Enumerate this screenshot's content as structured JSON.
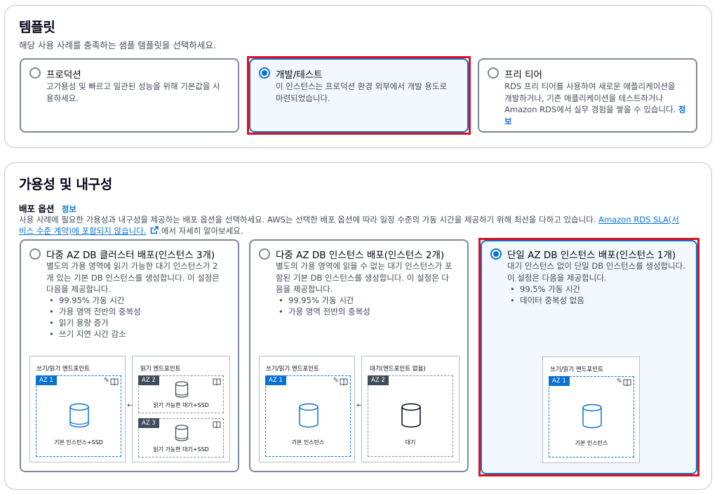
{
  "templates": {
    "title": "템플릿",
    "description": "해당 사용 사례를 충족하는 샘플 템플릿을 선택하세요.",
    "options": [
      {
        "label": "프로덕션",
        "desc_lines": [
          "고가용성 및 빠르고 일관된 성능을 위해 기본값을 사",
          "용하세요."
        ]
      },
      {
        "label": "개발/테스트",
        "desc_lines": [
          "이 인스턴스는 프로덕션 환경 외부에서 개발 용도로",
          "마련되었습니다."
        ]
      },
      {
        "label": "프리 티어",
        "desc_lines": [
          "RDS 프리 티어를 사용하여 새로운 애플리케이션을",
          "개발하거나, 기존 애플리케이션을 테스트하거나",
          "Amazon RDS에서 실무 경험을 쌓을 수 있습니다."
        ],
        "info_link_1": "정",
        "info_link_2": "보"
      }
    ],
    "selected": "개발/테스트"
  },
  "availability": {
    "title": "가용성 및 내구성",
    "deploy_label": "배포 옵션",
    "info_link": "정보",
    "desc_line1": "사용 사례에 필요한 가용성과 내구성을 제공하는 배포 옵션을 선택하세요. AWS는 선택한 배포 옵션에 따라 일정 수준의 가동 시간을 제공하기 위해 최선을 다하고 있습니다.",
    "sla_link_1": "Amazon RDS SLA(서",
    "sla_link_2": "비스 수준 계약)에 포함되지 않습니다.",
    "desc_tail": ".에서 자세히 알아보세요.",
    "options": [
      {
        "label": "다중 AZ DB 클러스터 배포(인스턴스 3개)",
        "desc_lines": [
          "별도의 가용 영역에 읽기 가능한 대기 인스턴스가 2",
          "개 있는 기본 DB 인스턴스를 생성합니다. 이 설정은",
          "다음을 제공합니다."
        ],
        "bullets": [
          "99.95% 가동 시간",
          "가용 영역 전반의 중복성",
          "읽기 용량 증가",
          "쓰기 지연 시간 감소"
        ],
        "diagram": {
          "write_ep": "쓰기/읽기 엔드포인트",
          "read_ep": "읽기 엔드포인트",
          "az1": "AZ 1",
          "az2": "AZ 2",
          "az3": "AZ 3",
          "primary": "기본 인스턴스+SSD",
          "readable1": "읽기 가능한 대기+SSD",
          "readable2": "읽기 가능한 대기+SSD"
        }
      },
      {
        "label": "다중 AZ DB 인스턴스 배포(인스턴스 2개)",
        "desc_lines": [
          "별도의 가용 영역에 읽을 수 없는 대기 인스턴스가 포",
          "함된 기본 DB 인스턴스를 생성합니다. 이 설정은 다",
          "음을 제공합니다."
        ],
        "bullets": [
          "99.95% 가동 시간",
          "가용 영역 전반의 중복성"
        ],
        "diagram": {
          "write_ep": "쓰기/읽기 엔드포인트",
          "standby_ep": "대기(엔드포인트 없음)",
          "az1": "AZ 1",
          "az2": "AZ 2",
          "primary": "기본 인스턴스",
          "standby": "대기"
        }
      },
      {
        "label": "단일 AZ DB 인스턴스 배포(인스턴스 1개)",
        "desc_lines": [
          "대기 인스턴스 없이 단일 DB 인스턴스를 생성합니다.",
          "이 설정은 다음을 제공합니다."
        ],
        "bullets": [
          "99.5% 가동 시간",
          "데이터 중복성 없음"
        ],
        "diagram": {
          "write_ep": "쓰기/읽기 엔드포인트",
          "az1": "AZ 1",
          "primary": "기본 인스턴스"
        }
      }
    ],
    "selected": "단일 AZ DB 인스턴스 배포(인스턴스 1개)"
  },
  "icons": {
    "radio": "radio-icon",
    "edit": "pencil-icon",
    "read": "book-icon",
    "database": "database-icon",
    "external": "external-link-icon",
    "sync": "bidirectional-arrow-icon"
  },
  "colors": {
    "accent": "#0972d3",
    "highlight": "#e0101c",
    "selected_bg": "#f2f8fd"
  }
}
